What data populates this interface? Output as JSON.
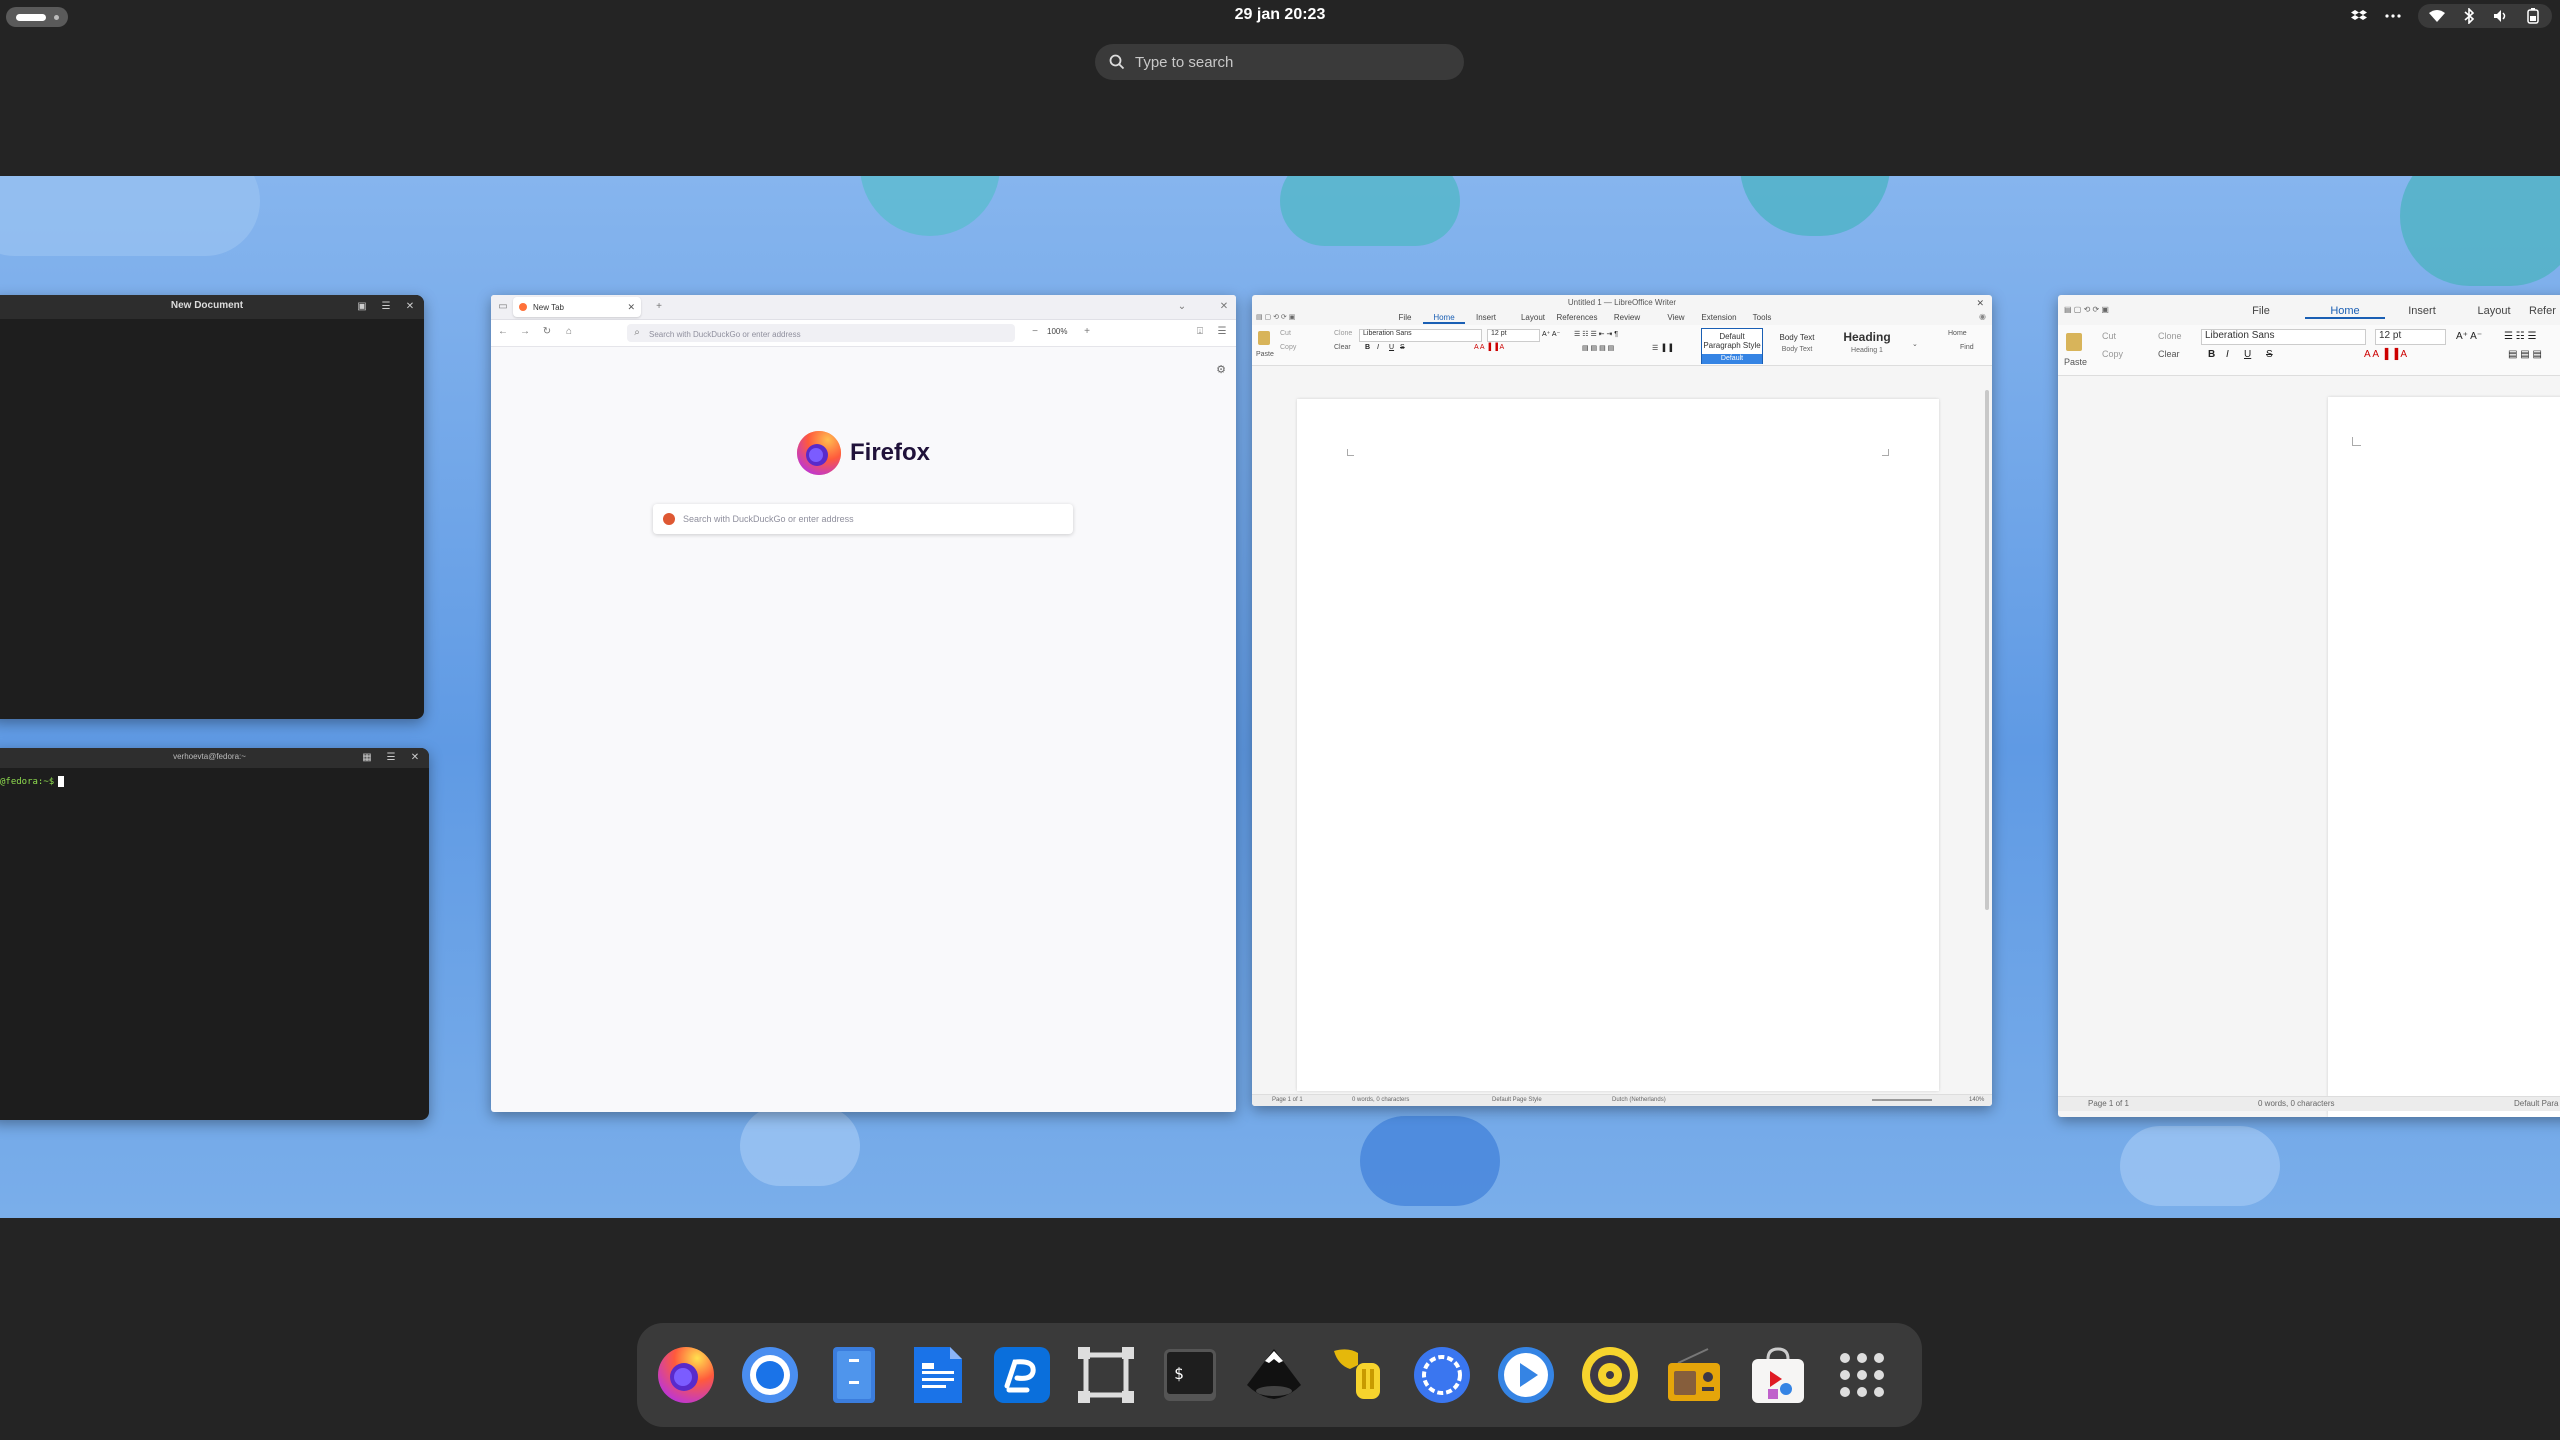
{
  "topbar": {
    "clock": "29 jan  20:23",
    "activities_icon": "activities-pill-icon",
    "tray_icons": [
      "dropbox-icon",
      "overflow-menu-icon",
      "wifi-icon",
      "bluetooth-icon",
      "volume-icon",
      "battery-icon"
    ]
  },
  "search": {
    "placeholder": "Type to search"
  },
  "windows": {
    "text_editor": {
      "title": "New Document"
    },
    "terminal": {
      "title": "verhoevta@fedora:~",
      "prompt": "@fedora:~$"
    },
    "firefox": {
      "tab_label": "New Tab",
      "url_placeholder": "Search with DuckDuckGo or enter address",
      "zoom": "100%",
      "brand": "Firefox",
      "search_placeholder": "Search with DuckDuckGo or enter address"
    },
    "writer1": {
      "title": "Untitled 1 — LibreOffice Writer",
      "menus": [
        "File",
        "Home",
        "Insert",
        "Layout",
        "References",
        "Review",
        "View",
        "Extension",
        "Tools"
      ],
      "active_menu": "Home",
      "paste": "Paste",
      "cut": "Cut",
      "copy": "Copy",
      "clone": "Clone",
      "clear": "Clear",
      "font_name": "Liberation Sans",
      "font_size": "12 pt",
      "styles": [
        {
          "top": "Default Paragraph Style",
          "bottom": "Default"
        },
        {
          "top": "Body Text",
          "bottom": "Body Text"
        },
        {
          "top": "Heading",
          "bottom": "Heading 1"
        }
      ],
      "home_dropdown": "Home",
      "find": "Find",
      "status": {
        "page": "Page 1 of 1",
        "words": "0 words, 0 characters",
        "page_style": "Default Page Style",
        "language": "Dutch (Netherlands)",
        "zoom": "140%"
      }
    },
    "writer2": {
      "menus": [
        "File",
        "Home",
        "Insert",
        "Layout",
        "Refer"
      ],
      "active_menu": "Home",
      "paste": "Paste",
      "cut": "Cut",
      "copy": "Copy",
      "clone": "Clone",
      "clear": "Clear",
      "font_name": "Liberation Sans",
      "font_size": "12 pt",
      "status": {
        "page": "Page 1 of 1",
        "words": "0 words, 0 characters",
        "style": "Default Para"
      }
    }
  },
  "dock": {
    "apps": [
      {
        "name": "Firefox",
        "icon": "firefox-icon"
      },
      {
        "name": "Chromium",
        "icon": "chromium-icon"
      },
      {
        "name": "Files",
        "icon": "files-icon"
      },
      {
        "name": "LibreOffice Writer",
        "icon": "libreoffice-writer-icon"
      },
      {
        "name": "Pika",
        "icon": "pika-icon"
      },
      {
        "name": "Boxes",
        "icon": "boxes-icon"
      },
      {
        "name": "Terminal",
        "icon": "terminal-icon"
      },
      {
        "name": "Inkscape",
        "icon": "inkscape-icon"
      },
      {
        "name": "Tuba",
        "icon": "tuba-icon"
      },
      {
        "name": "Signal",
        "icon": "signal-icon"
      },
      {
        "name": "Parabolic",
        "icon": "parabolic-icon"
      },
      {
        "name": "Amberol",
        "icon": "amberol-icon"
      },
      {
        "name": "Shortwave",
        "icon": "shortwave-icon"
      },
      {
        "name": "Software",
        "icon": "software-icon"
      },
      {
        "name": "Show Apps",
        "icon": "app-grid-icon"
      }
    ]
  },
  "colors": {
    "accent": "#3584e4",
    "wallpaper_light": "#86b5ee",
    "wallpaper_dark": "#5f9ae4",
    "panel": "#242424"
  }
}
